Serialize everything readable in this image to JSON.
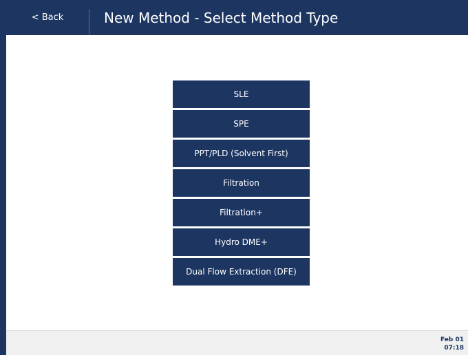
{
  "header": {
    "back_label": "< Back",
    "title": "New Method - Select Method Type"
  },
  "methods": [
    {
      "label": "SLE"
    },
    {
      "label": "SPE"
    },
    {
      "label": "PPT/PLD (Solvent First)"
    },
    {
      "label": "Filtration"
    },
    {
      "label": "Filtration+"
    },
    {
      "label": "Hydro DME+"
    },
    {
      "label": "Dual Flow Extraction (DFE)"
    }
  ],
  "footer": {
    "date": "Feb 01",
    "time": "07:18"
  },
  "colors": {
    "primary": "#1c3561",
    "footer_bg": "#f0f0f0",
    "text_on_primary": "#ffffff"
  }
}
